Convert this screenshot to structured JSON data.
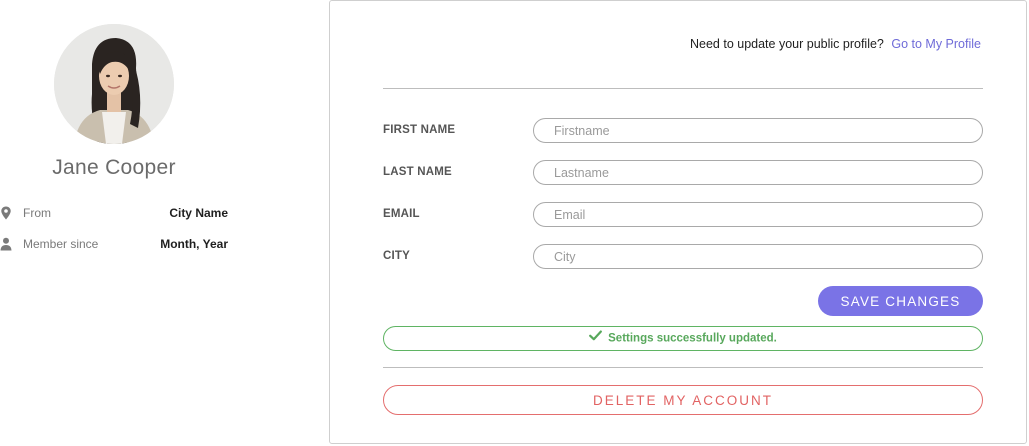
{
  "profile": {
    "name": "Jane Cooper",
    "from_label": "From",
    "from_value": "City Name",
    "member_label": "Member since",
    "member_value": "Month, Year",
    "icons": {
      "from": "map-pin-icon",
      "member": "user-icon"
    }
  },
  "header": {
    "prompt": "Need to update your public profile?",
    "link": "Go to My Profile"
  },
  "form": {
    "fields": [
      {
        "label": "FIRST NAME",
        "placeholder": "Firstname",
        "value": ""
      },
      {
        "label": "LAST NAME",
        "placeholder": "Lastname",
        "value": ""
      },
      {
        "label": "EMAIL",
        "placeholder": "Email",
        "value": ""
      },
      {
        "label": "CITY",
        "placeholder": "City",
        "value": ""
      }
    ],
    "save_label": "SAVE CHANGES",
    "success_message": "Settings successfully updated.",
    "delete_label": "DELETE MY ACCOUNT"
  },
  "colors": {
    "accent": "#7a73e6",
    "link": "#6f6bd8",
    "success": "#5fb463",
    "danger": "#e26363"
  }
}
